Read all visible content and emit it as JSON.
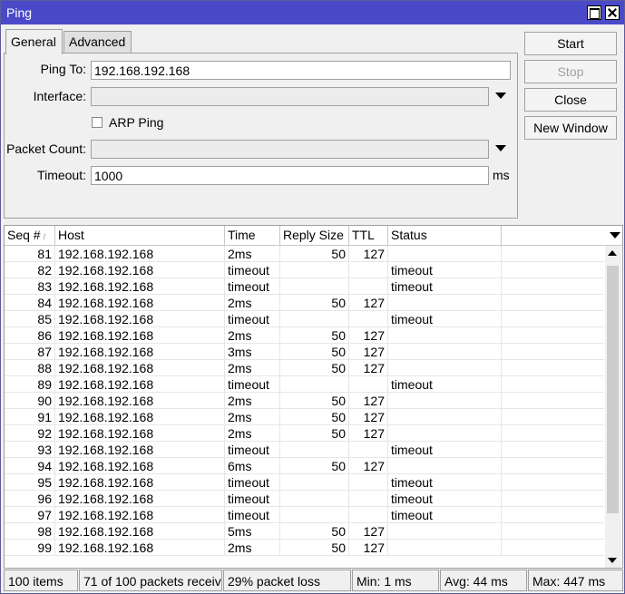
{
  "window": {
    "title": "Ping"
  },
  "tabs": [
    {
      "label": "General"
    },
    {
      "label": "Advanced"
    }
  ],
  "form": {
    "ping_to": {
      "label": "Ping To:",
      "value": "192.168.192.168"
    },
    "interface": {
      "label": "Interface:",
      "value": ""
    },
    "arp_ping": {
      "label": "ARP Ping",
      "checked": false
    },
    "packet_count": {
      "label": "Packet Count:",
      "value": ""
    },
    "timeout": {
      "label": "Timeout:",
      "value": "1000",
      "unit": "ms"
    }
  },
  "buttons": {
    "start": "Start",
    "stop": "Stop",
    "close": "Close",
    "new_window": "New Window"
  },
  "table": {
    "columns": [
      "Seq #",
      "Host",
      "Time",
      "Reply Size",
      "TTL",
      "Status"
    ],
    "rows": [
      [
        "81",
        "192.168.192.168",
        "2ms",
        "50",
        "127",
        ""
      ],
      [
        "82",
        "192.168.192.168",
        "timeout",
        "",
        "",
        "timeout"
      ],
      [
        "83",
        "192.168.192.168",
        "timeout",
        "",
        "",
        "timeout"
      ],
      [
        "84",
        "192.168.192.168",
        "2ms",
        "50",
        "127",
        ""
      ],
      [
        "85",
        "192.168.192.168",
        "timeout",
        "",
        "",
        "timeout"
      ],
      [
        "86",
        "192.168.192.168",
        "2ms",
        "50",
        "127",
        ""
      ],
      [
        "87",
        "192.168.192.168",
        "3ms",
        "50",
        "127",
        ""
      ],
      [
        "88",
        "192.168.192.168",
        "2ms",
        "50",
        "127",
        ""
      ],
      [
        "89",
        "192.168.192.168",
        "timeout",
        "",
        "",
        "timeout"
      ],
      [
        "90",
        "192.168.192.168",
        "2ms",
        "50",
        "127",
        ""
      ],
      [
        "91",
        "192.168.192.168",
        "2ms",
        "50",
        "127",
        ""
      ],
      [
        "92",
        "192.168.192.168",
        "2ms",
        "50",
        "127",
        ""
      ],
      [
        "93",
        "192.168.192.168",
        "timeout",
        "",
        "",
        "timeout"
      ],
      [
        "94",
        "192.168.192.168",
        "6ms",
        "50",
        "127",
        ""
      ],
      [
        "95",
        "192.168.192.168",
        "timeout",
        "",
        "",
        "timeout"
      ],
      [
        "96",
        "192.168.192.168",
        "timeout",
        "",
        "",
        "timeout"
      ],
      [
        "97",
        "192.168.192.168",
        "timeout",
        "",
        "",
        "timeout"
      ],
      [
        "98",
        "192.168.192.168",
        "5ms",
        "50",
        "127",
        ""
      ],
      [
        "99",
        "192.168.192.168",
        "2ms",
        "50",
        "127",
        ""
      ]
    ]
  },
  "status_bar": {
    "items": "100 items",
    "received": "71 of 100 packets receiv...",
    "loss": "29% packet loss",
    "min": "Min: 1 ms",
    "avg": "Avg: 44 ms",
    "max": "Max: 447 ms"
  },
  "colors": {
    "titlebar": "#4a4ac8",
    "window_bg": "#f0f0f0"
  },
  "icons": [
    "maximize-icon",
    "close-icon",
    "chevron-down-icon",
    "sort-icon",
    "scroll-up-icon",
    "scroll-down-icon"
  ]
}
